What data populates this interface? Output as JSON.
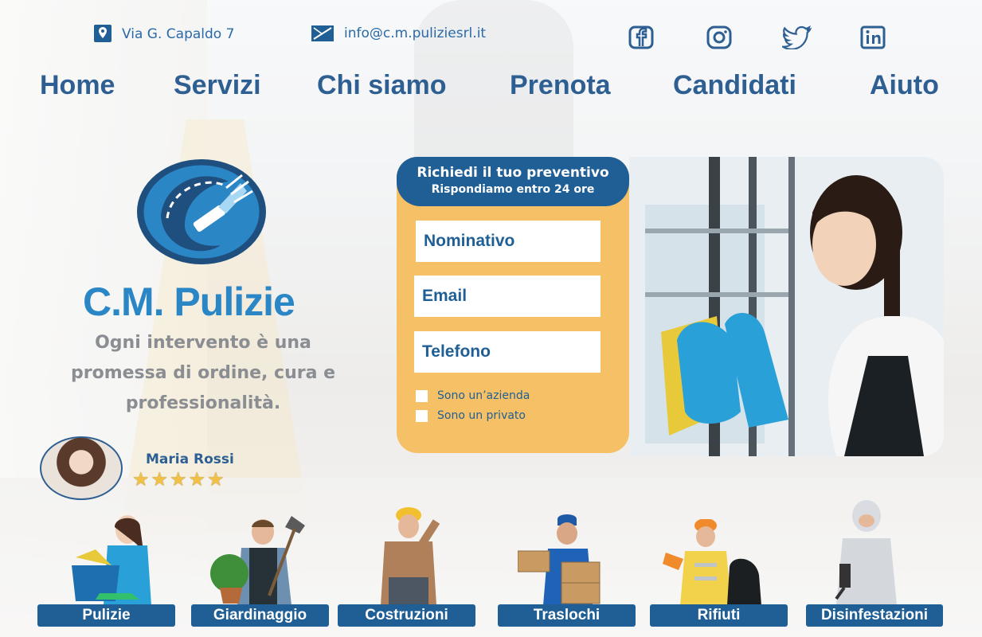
{
  "contact": {
    "address": "Via G. Capaldo 7",
    "email": "info@c.m.puliziesrl.it",
    "social": [
      "facebook-icon",
      "instagram-icon",
      "twitter-icon",
      "linkedin-icon"
    ]
  },
  "nav": {
    "home": "Home",
    "servizi": "Servizi",
    "chi_siamo": "Chi siamo",
    "prenota": "Prenota",
    "candidati": "Candidati",
    "aiuto": "Aiuto"
  },
  "brand": {
    "name": "C.M. Pulizie",
    "tagline_1": "Ogni intervento è una",
    "tagline_2": "promessa di ordine, cura e",
    "tagline_3": "professionalità."
  },
  "review": {
    "name": "Maria Rossi",
    "stars": "★★★★★",
    "rating": 5
  },
  "form": {
    "title": "Richiedi il tuo preventivo",
    "subtitle": "Rispondiamo entro 24 ore",
    "nominativo_placeholder": "Nominativo",
    "email_placeholder": "Email",
    "telefono_placeholder": "Telefono",
    "option_azienda": "Sono un’azienda",
    "option_privato": "Sono un privato"
  },
  "services": [
    "Pulizie",
    "Giardinaggio",
    "Costruzioni",
    "Traslochi",
    "Rifiuti",
    "Disinfestazioni"
  ],
  "colors": {
    "primary": "#1f5f95",
    "accent": "#2b86c6",
    "form_bg": "#f5c066",
    "star": "#f1c146"
  }
}
